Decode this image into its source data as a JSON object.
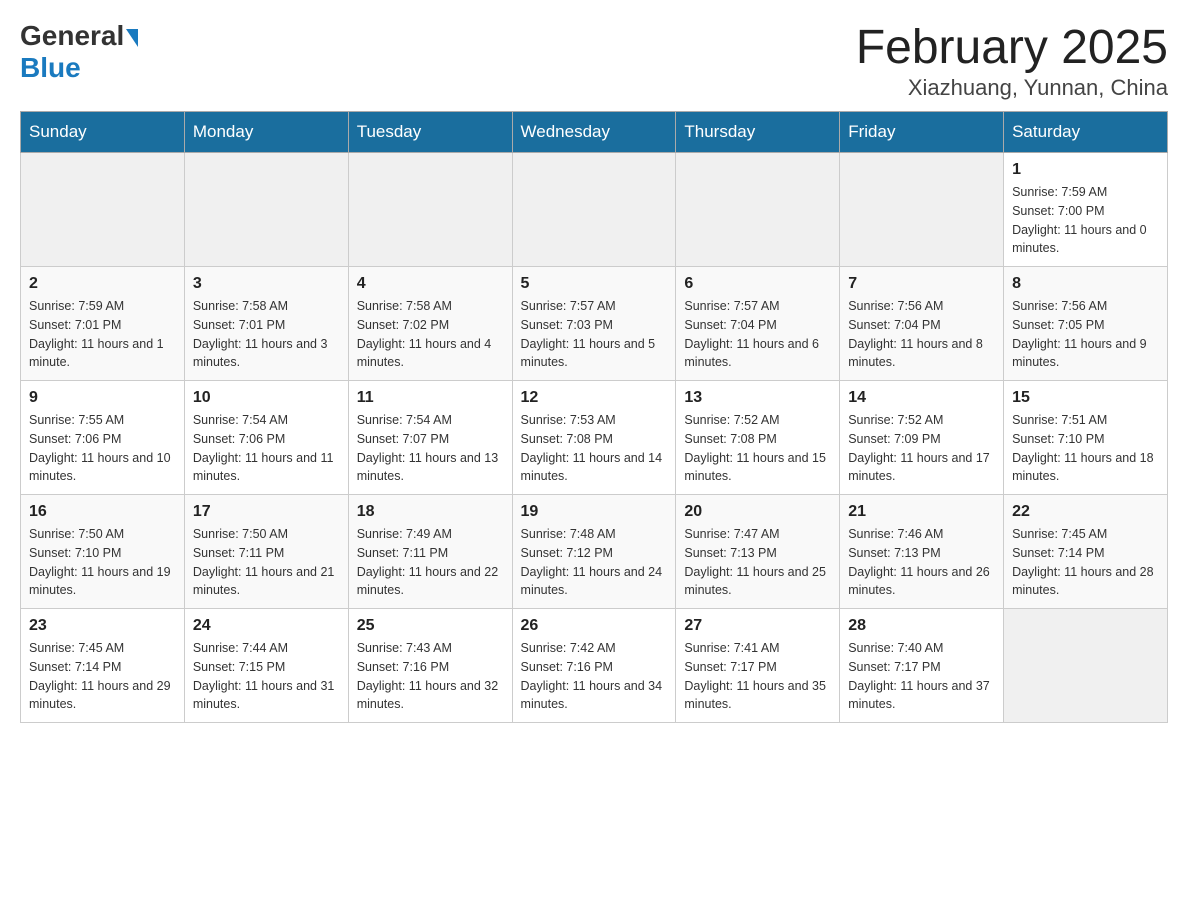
{
  "header": {
    "logo_general": "General",
    "logo_blue": "Blue",
    "month_title": "February 2025",
    "location": "Xiazhuang, Yunnan, China"
  },
  "days_of_week": [
    "Sunday",
    "Monday",
    "Tuesday",
    "Wednesday",
    "Thursday",
    "Friday",
    "Saturday"
  ],
  "weeks": [
    [
      {
        "day": "",
        "sunrise": "",
        "sunset": "",
        "daylight": ""
      },
      {
        "day": "",
        "sunrise": "",
        "sunset": "",
        "daylight": ""
      },
      {
        "day": "",
        "sunrise": "",
        "sunset": "",
        "daylight": ""
      },
      {
        "day": "",
        "sunrise": "",
        "sunset": "",
        "daylight": ""
      },
      {
        "day": "",
        "sunrise": "",
        "sunset": "",
        "daylight": ""
      },
      {
        "day": "",
        "sunrise": "",
        "sunset": "",
        "daylight": ""
      },
      {
        "day": "1",
        "sunrise": "Sunrise: 7:59 AM",
        "sunset": "Sunset: 7:00 PM",
        "daylight": "Daylight: 11 hours and 0 minutes."
      }
    ],
    [
      {
        "day": "2",
        "sunrise": "Sunrise: 7:59 AM",
        "sunset": "Sunset: 7:01 PM",
        "daylight": "Daylight: 11 hours and 1 minute."
      },
      {
        "day": "3",
        "sunrise": "Sunrise: 7:58 AM",
        "sunset": "Sunset: 7:01 PM",
        "daylight": "Daylight: 11 hours and 3 minutes."
      },
      {
        "day": "4",
        "sunrise": "Sunrise: 7:58 AM",
        "sunset": "Sunset: 7:02 PM",
        "daylight": "Daylight: 11 hours and 4 minutes."
      },
      {
        "day": "5",
        "sunrise": "Sunrise: 7:57 AM",
        "sunset": "Sunset: 7:03 PM",
        "daylight": "Daylight: 11 hours and 5 minutes."
      },
      {
        "day": "6",
        "sunrise": "Sunrise: 7:57 AM",
        "sunset": "Sunset: 7:04 PM",
        "daylight": "Daylight: 11 hours and 6 minutes."
      },
      {
        "day": "7",
        "sunrise": "Sunrise: 7:56 AM",
        "sunset": "Sunset: 7:04 PM",
        "daylight": "Daylight: 11 hours and 8 minutes."
      },
      {
        "day": "8",
        "sunrise": "Sunrise: 7:56 AM",
        "sunset": "Sunset: 7:05 PM",
        "daylight": "Daylight: 11 hours and 9 minutes."
      }
    ],
    [
      {
        "day": "9",
        "sunrise": "Sunrise: 7:55 AM",
        "sunset": "Sunset: 7:06 PM",
        "daylight": "Daylight: 11 hours and 10 minutes."
      },
      {
        "day": "10",
        "sunrise": "Sunrise: 7:54 AM",
        "sunset": "Sunset: 7:06 PM",
        "daylight": "Daylight: 11 hours and 11 minutes."
      },
      {
        "day": "11",
        "sunrise": "Sunrise: 7:54 AM",
        "sunset": "Sunset: 7:07 PM",
        "daylight": "Daylight: 11 hours and 13 minutes."
      },
      {
        "day": "12",
        "sunrise": "Sunrise: 7:53 AM",
        "sunset": "Sunset: 7:08 PM",
        "daylight": "Daylight: 11 hours and 14 minutes."
      },
      {
        "day": "13",
        "sunrise": "Sunrise: 7:52 AM",
        "sunset": "Sunset: 7:08 PM",
        "daylight": "Daylight: 11 hours and 15 minutes."
      },
      {
        "day": "14",
        "sunrise": "Sunrise: 7:52 AM",
        "sunset": "Sunset: 7:09 PM",
        "daylight": "Daylight: 11 hours and 17 minutes."
      },
      {
        "day": "15",
        "sunrise": "Sunrise: 7:51 AM",
        "sunset": "Sunset: 7:10 PM",
        "daylight": "Daylight: 11 hours and 18 minutes."
      }
    ],
    [
      {
        "day": "16",
        "sunrise": "Sunrise: 7:50 AM",
        "sunset": "Sunset: 7:10 PM",
        "daylight": "Daylight: 11 hours and 19 minutes."
      },
      {
        "day": "17",
        "sunrise": "Sunrise: 7:50 AM",
        "sunset": "Sunset: 7:11 PM",
        "daylight": "Daylight: 11 hours and 21 minutes."
      },
      {
        "day": "18",
        "sunrise": "Sunrise: 7:49 AM",
        "sunset": "Sunset: 7:11 PM",
        "daylight": "Daylight: 11 hours and 22 minutes."
      },
      {
        "day": "19",
        "sunrise": "Sunrise: 7:48 AM",
        "sunset": "Sunset: 7:12 PM",
        "daylight": "Daylight: 11 hours and 24 minutes."
      },
      {
        "day": "20",
        "sunrise": "Sunrise: 7:47 AM",
        "sunset": "Sunset: 7:13 PM",
        "daylight": "Daylight: 11 hours and 25 minutes."
      },
      {
        "day": "21",
        "sunrise": "Sunrise: 7:46 AM",
        "sunset": "Sunset: 7:13 PM",
        "daylight": "Daylight: 11 hours and 26 minutes."
      },
      {
        "day": "22",
        "sunrise": "Sunrise: 7:45 AM",
        "sunset": "Sunset: 7:14 PM",
        "daylight": "Daylight: 11 hours and 28 minutes."
      }
    ],
    [
      {
        "day": "23",
        "sunrise": "Sunrise: 7:45 AM",
        "sunset": "Sunset: 7:14 PM",
        "daylight": "Daylight: 11 hours and 29 minutes."
      },
      {
        "day": "24",
        "sunrise": "Sunrise: 7:44 AM",
        "sunset": "Sunset: 7:15 PM",
        "daylight": "Daylight: 11 hours and 31 minutes."
      },
      {
        "day": "25",
        "sunrise": "Sunrise: 7:43 AM",
        "sunset": "Sunset: 7:16 PM",
        "daylight": "Daylight: 11 hours and 32 minutes."
      },
      {
        "day": "26",
        "sunrise": "Sunrise: 7:42 AM",
        "sunset": "Sunset: 7:16 PM",
        "daylight": "Daylight: 11 hours and 34 minutes."
      },
      {
        "day": "27",
        "sunrise": "Sunrise: 7:41 AM",
        "sunset": "Sunset: 7:17 PM",
        "daylight": "Daylight: 11 hours and 35 minutes."
      },
      {
        "day": "28",
        "sunrise": "Sunrise: 7:40 AM",
        "sunset": "Sunset: 7:17 PM",
        "daylight": "Daylight: 11 hours and 37 minutes."
      },
      {
        "day": "",
        "sunrise": "",
        "sunset": "",
        "daylight": ""
      }
    ]
  ]
}
